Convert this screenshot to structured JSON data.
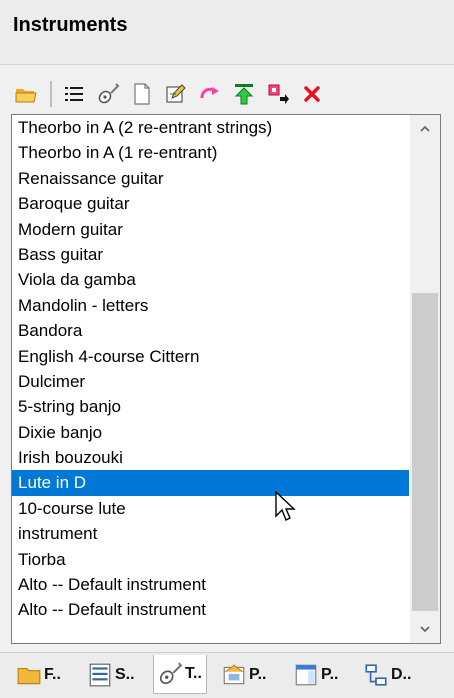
{
  "panel": {
    "title": "Instruments"
  },
  "toolbar": {
    "buttons": [
      {
        "name": "open",
        "icon": "folder-open-icon"
      },
      {
        "name": "list",
        "icon": "list-icon"
      },
      {
        "name": "instrument",
        "icon": "guitar-icon"
      },
      {
        "name": "new",
        "icon": "new-document-icon"
      },
      {
        "name": "edit",
        "icon": "edit-icon"
      },
      {
        "name": "redo",
        "icon": "redo-arrow-icon"
      },
      {
        "name": "move-top",
        "icon": "move-to-top-icon"
      },
      {
        "name": "export",
        "icon": "export-arrow-icon"
      },
      {
        "name": "delete",
        "icon": "delete-icon"
      }
    ]
  },
  "list": {
    "items": [
      "Theorbo in A (2 re-entrant strings)",
      "Theorbo in A (1 re-entrant)",
      "Renaissance guitar",
      "Baroque guitar",
      "Modern guitar",
      "Bass guitar",
      "Viola da gamba",
      "Mandolin - letters",
      "Bandora",
      "English 4-course Cittern",
      "Dulcimer",
      "5-string banjo",
      "Dixie banjo",
      "Irish bouzouki",
      "Lute in D",
      "10-course lute",
      "instrument",
      "Tiorba",
      "Alto -- Default instrument",
      "Alto -- Default instrument"
    ],
    "selected_index": 14
  },
  "tabs": [
    {
      "label": "F..",
      "icon": "folder-icon"
    },
    {
      "label": "S..",
      "icon": "score-icon"
    },
    {
      "label": "T..",
      "icon": "guitar-icon",
      "active": true
    },
    {
      "label": "P..",
      "icon": "properties-icon"
    },
    {
      "label": "P..",
      "icon": "page-icon"
    },
    {
      "label": "D..",
      "icon": "diagram-icon"
    }
  ],
  "colors": {
    "selection": "#0078d7",
    "delete": "#e81123",
    "move_top": "#2ecc40",
    "redo": "#ff3fa4",
    "folder": "#f0b93b"
  }
}
